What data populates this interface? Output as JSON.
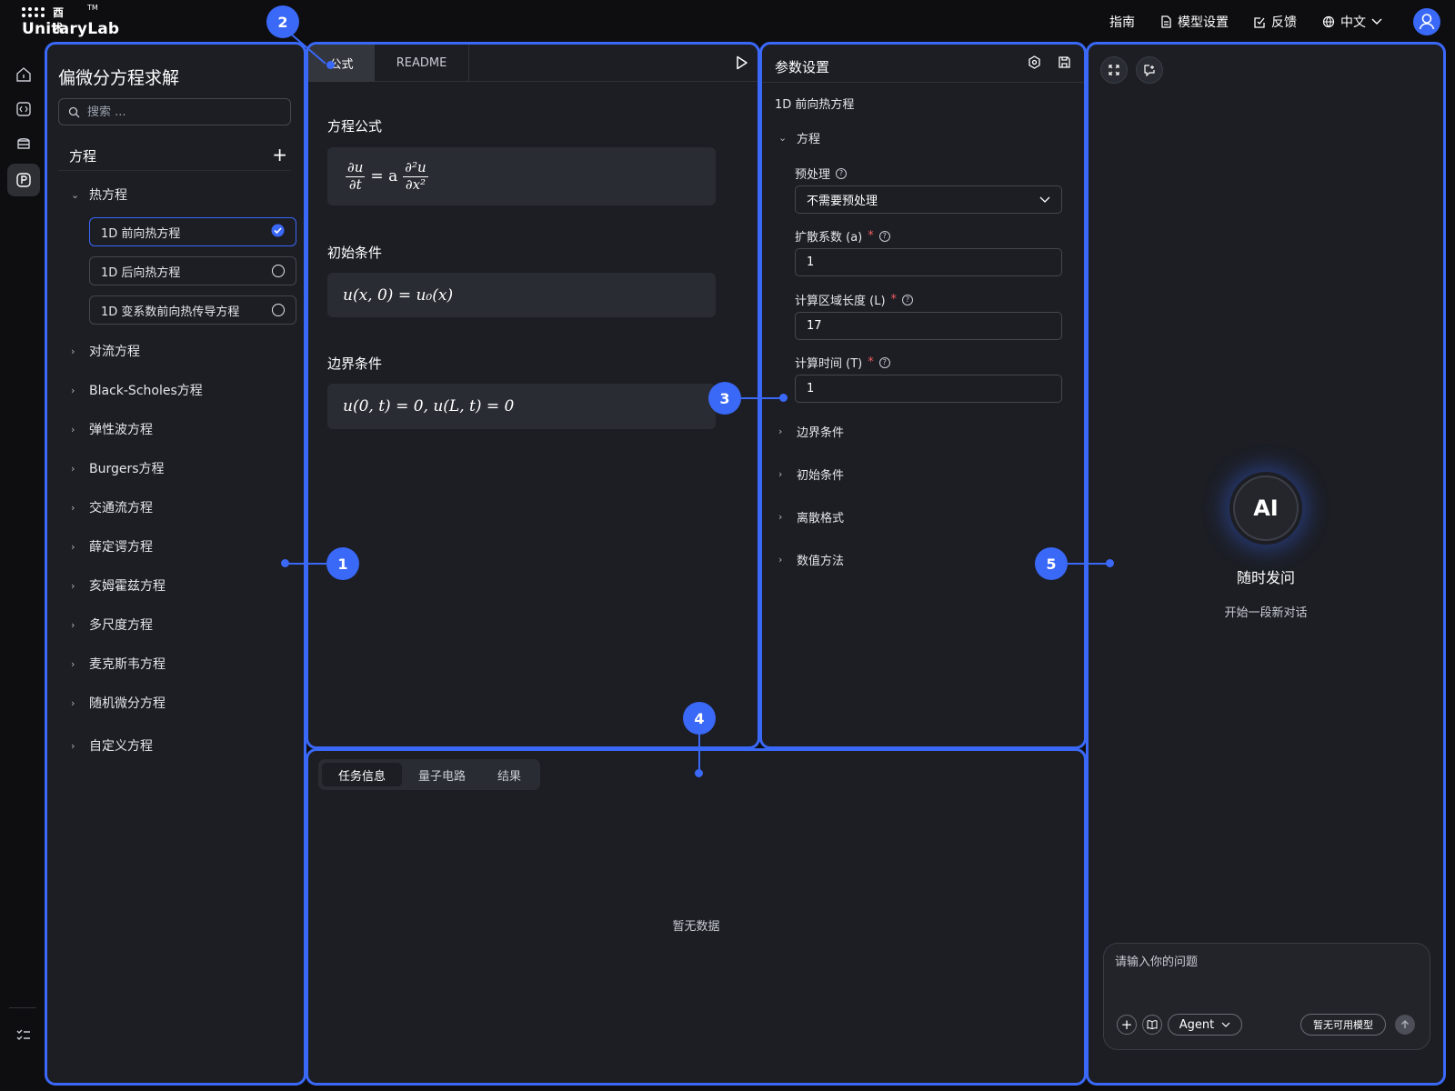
{
  "brand": {
    "cn": "酉术",
    "tm": "TM",
    "en": "UnitaryLab"
  },
  "topnav": {
    "guide": "指南",
    "model_settings": "模型设置",
    "feedback": "反馈",
    "language": "中文"
  },
  "colors": {
    "accent": "#3a68f7",
    "panel_bg": "#1c1e24",
    "page_bg": "#0e0e10",
    "required": "#f25b5b"
  },
  "rail": {
    "icons": [
      "home-icon",
      "code-icon",
      "stack-icon",
      "p-badge-icon",
      "checklist-icon"
    ],
    "active_index": 3
  },
  "sidebar": {
    "title": "偏微分方程求解",
    "search_placeholder": "搜索 ...",
    "section": "方程",
    "expanded": {
      "label": "热方程",
      "items": [
        {
          "label": "1D 前向热方程",
          "selected": true
        },
        {
          "label": "1D 后向热方程",
          "selected": false
        },
        {
          "label": "1D 变系数前向热传导方程",
          "selected": false
        }
      ]
    },
    "collapsed": [
      "对流方程",
      "Black-Scholes方程",
      "弹性波方程",
      "Burgers方程",
      "交通流方程",
      "薛定谔方程",
      "亥姆霍兹方程",
      "多尺度方程",
      "麦克斯韦方程",
      "随机微分方程",
      "自定义方程"
    ]
  },
  "formula_panel": {
    "tabs": [
      "公式",
      "README"
    ],
    "active_tab": 0,
    "equation_title": "方程公式",
    "equation": {
      "lhs_num": "∂u",
      "lhs_den": "∂t",
      "eq": "= a",
      "rhs_num": "∂²u",
      "rhs_den": "∂x²"
    },
    "initial_title": "初始条件",
    "initial": "u(x, 0) = u₀(x)",
    "boundary_title": "边界条件",
    "boundary": "u(0, t) = 0, u(L, t) = 0"
  },
  "params": {
    "title": "参数设置",
    "subtitle": "1D 前向热方程",
    "group": "方程",
    "fields": [
      {
        "label": "预处理",
        "required": false,
        "value": "不需要预处理",
        "type": "select"
      },
      {
        "label": "扩散系数 (a)",
        "required": true,
        "value": "1",
        "type": "input"
      },
      {
        "label": "计算区域长度 (L)",
        "required": true,
        "value": "17",
        "type": "input"
      },
      {
        "label": "计算时间 (T)",
        "required": true,
        "value": "1",
        "type": "input"
      }
    ],
    "collapsed_groups": [
      "边界条件",
      "初始条件",
      "离散格式",
      "数值方法"
    ]
  },
  "results": {
    "tabs": [
      "任务信息",
      "量子电路",
      "结果"
    ],
    "active_tab": 0,
    "empty": "暂无数据"
  },
  "assistant": {
    "badge": "AI",
    "title": "随时发问",
    "subtitle": "开始一段新对话",
    "input_placeholder": "请输入你的问题",
    "agent_label": "Agent",
    "model_label": "暂无可用模型"
  },
  "callouts": [
    "1",
    "2",
    "3",
    "4",
    "5"
  ]
}
